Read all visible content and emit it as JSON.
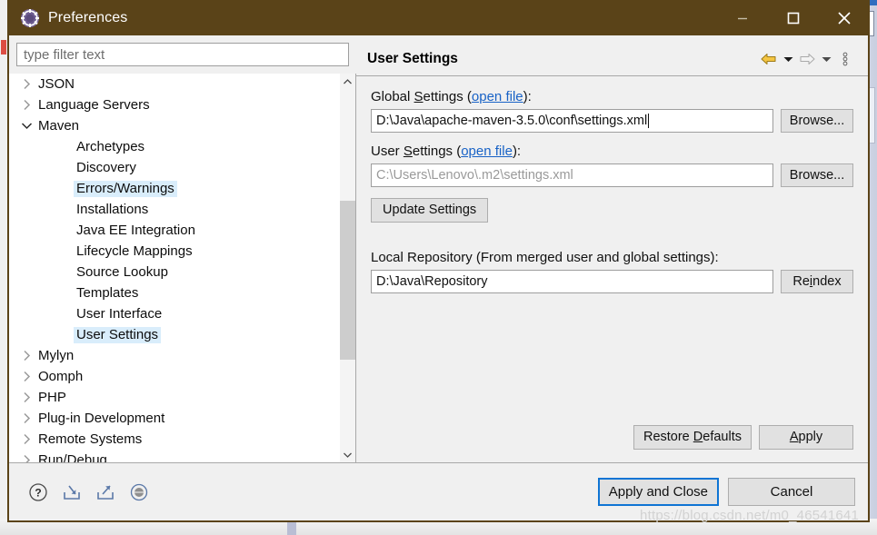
{
  "window": {
    "title": "Preferences",
    "icon": "gear-icon",
    "titlebar_color": "#5a4318",
    "controls": {
      "minimize": "–",
      "maximize": "□",
      "close": "✕"
    }
  },
  "filter": {
    "placeholder": "type filter text",
    "value": ""
  },
  "tree": {
    "items": [
      {
        "label": "JSON",
        "level": 0,
        "arrow": "collapsed",
        "selected": false
      },
      {
        "label": "Language Servers",
        "level": 0,
        "arrow": "collapsed",
        "selected": false
      },
      {
        "label": "Maven",
        "level": 0,
        "arrow": "expanded",
        "selected": false
      },
      {
        "label": "Archetypes",
        "level": 1,
        "arrow": "none",
        "selected": false
      },
      {
        "label": "Discovery",
        "level": 1,
        "arrow": "none",
        "selected": false
      },
      {
        "label": "Errors/Warnings",
        "level": 1,
        "arrow": "none",
        "selected": true
      },
      {
        "label": "Installations",
        "level": 1,
        "arrow": "none",
        "selected": false
      },
      {
        "label": "Java EE Integration",
        "level": 1,
        "arrow": "none",
        "selected": false
      },
      {
        "label": "Lifecycle Mappings",
        "level": 1,
        "arrow": "none",
        "selected": false
      },
      {
        "label": "Source Lookup",
        "level": 1,
        "arrow": "none",
        "selected": false
      },
      {
        "label": "Templates",
        "level": 1,
        "arrow": "none",
        "selected": false
      },
      {
        "label": "User Interface",
        "level": 1,
        "arrow": "none",
        "selected": false
      },
      {
        "label": "User Settings",
        "level": 1,
        "arrow": "none",
        "selected": true
      },
      {
        "label": "Mylyn",
        "level": 0,
        "arrow": "collapsed",
        "selected": false
      },
      {
        "label": "Oomph",
        "level": 0,
        "arrow": "collapsed",
        "selected": false
      },
      {
        "label": "PHP",
        "level": 0,
        "arrow": "collapsed",
        "selected": false
      },
      {
        "label": "Plug-in Development",
        "level": 0,
        "arrow": "collapsed",
        "selected": false
      },
      {
        "label": "Remote Systems",
        "level": 0,
        "arrow": "collapsed",
        "selected": false
      },
      {
        "label": "Run/Debug",
        "level": 0,
        "arrow": "collapsed",
        "selected": false
      }
    ],
    "scrollbar": {
      "up_icon": "chevron-up-icon",
      "down_icon": "chevron-down-icon"
    }
  },
  "page": {
    "title": "User Settings",
    "toolbar": {
      "back_icon": "back-arrow-icon",
      "back_dropdown_icon": "caret-down-icon",
      "forward_icon": "forward-arrow-icon",
      "forward_dropdown_icon": "caret-down-icon",
      "menu_icon": "vertical-dots-icon"
    },
    "global_settings": {
      "label_prefix": "Global ",
      "label_mnemonic": "S",
      "label_rest": "ettings (",
      "link": "open file",
      "label_suffix": "):",
      "value": "D:\\Java\\apache-maven-3.5.0\\conf\\settings.xml",
      "browse_label": "Browse..."
    },
    "user_settings": {
      "label_prefix": "User ",
      "label_mnemonic": "S",
      "label_rest": "ettings (",
      "link": "open file",
      "label_suffix": "):",
      "value": "C:\\Users\\Lenovo\\.m2\\settings.xml",
      "browse_label": "Browse..."
    },
    "update_settings_label": "Update Settings",
    "local_repository": {
      "label": "Local Repository (From merged user and global settings):",
      "value": "D:\\Java\\Repository",
      "reindex_prefix": "Re",
      "reindex_mnemonic": "i",
      "reindex_rest": "ndex"
    },
    "restore_defaults": {
      "prefix": "Restore ",
      "mnemonic": "D",
      "rest": "efaults"
    },
    "apply": {
      "mnemonic": "A",
      "rest": "pply"
    }
  },
  "footer": {
    "icons": [
      {
        "name": "help-icon",
        "title": "Help"
      },
      {
        "name": "import-icon",
        "title": "Import"
      },
      {
        "name": "export-icon",
        "title": "Export"
      },
      {
        "name": "status-icon",
        "title": "Status"
      }
    ],
    "apply_and_close_label": "Apply and Close",
    "cancel_label": "Cancel",
    "focus_color": "#0f74d4"
  },
  "watermark": "https://blog.csdn.net/m0_46541641"
}
